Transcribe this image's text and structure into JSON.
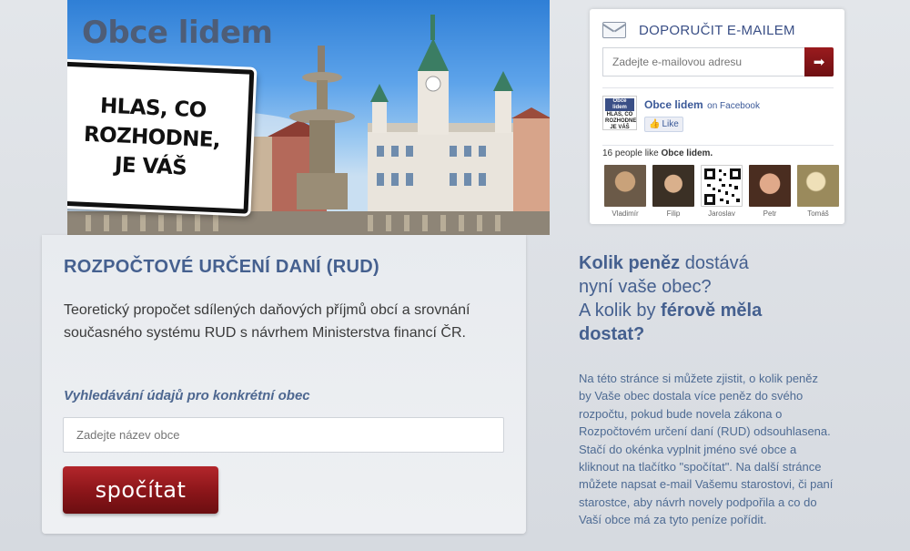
{
  "hero": {
    "site_title": "Obce lidem",
    "sign_text": "HLAS, CO\nROZHODNE,\nJE VÁŠ"
  },
  "email_box": {
    "title": "DOPORUČIT E-MAILEM",
    "placeholder": "Zadejte e-mailovou adresu",
    "submit_icon": "arrow-right-icon"
  },
  "facebook": {
    "thumb_title": "Obce lidem",
    "thumb_text": "HLAS, CO ROZHODNE, JE VÁŠ",
    "page_name": "Obce lidem",
    "on_facebook": "on Facebook",
    "like_label": "Like",
    "count_prefix": "16 people like",
    "count_page": "Obce lidem.",
    "faces": [
      {
        "name": "Vladimír",
        "color": "#6b5a48"
      },
      {
        "name": "Filip",
        "color": "#3b3025"
      },
      {
        "name": "Jaroslav",
        "color": "#222222"
      },
      {
        "name": "Petr",
        "color": "#7a4a30"
      },
      {
        "name": "Tomáš",
        "color": "#9a8a5c"
      }
    ]
  },
  "main": {
    "title": "ROZPOČTOVÉ URČENÍ DANÍ (RUD)",
    "description": "Teoretický propočet sdílených daňových příjmů obcí a srovnání současného systému RUD s návrhem Ministerstva financí ČR.",
    "search_heading": "Vyhledávání údajů pro konkrétní obec",
    "search_placeholder": "Zadejte název obce",
    "calc_label": "spočítat"
  },
  "side": {
    "q1_bold": "Kolik peněz",
    "q1_rest": "dostává",
    "q2": "nyní vaše obec?",
    "q3_start": "A kolik by",
    "q3_bold": "férově měla",
    "q4_bold": "dostat?",
    "info": "Na této stránce si můžete zjistit, o kolik peněz by Vaše obec dostala více peněz do svého rozpočtu, pokud bude novela zákona o Rozpočtovém určení daní (RUD) odsouhlasena. Stačí do okénka vyplnit jméno své obce a kliknout na tlačítko \"spočítat\". Na další stránce můžete napsat e-mail Vašemu starostovi, či paní starostce, aby návrh novely podpořila a co do Vaší obce má za tyto peníze pořídit."
  },
  "colors": {
    "accent_blue": "#45608f",
    "button_red": "#8a1519",
    "facebook_blue": "#3b5998"
  }
}
